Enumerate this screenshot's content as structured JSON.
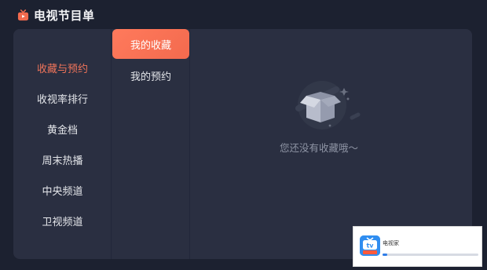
{
  "header": {
    "title": "电视节目单",
    "icon": "tv-icon",
    "icon_color": "#f36a4e"
  },
  "categories": [
    {
      "label": "收藏与预约",
      "active": true
    },
    {
      "label": "收视率排行",
      "active": false
    },
    {
      "label": "黄金档",
      "active": false
    },
    {
      "label": "周末热播",
      "active": false
    },
    {
      "label": "中央频道",
      "active": false
    },
    {
      "label": "卫视频道",
      "active": false
    }
  ],
  "subtabs": [
    {
      "label": "我的收藏",
      "active": true
    },
    {
      "label": "我的预约",
      "active": false
    }
  ],
  "empty_state": {
    "icon": "empty-box-icon",
    "message": "您还没有收藏哦～"
  },
  "popup": {
    "app_name": "电视家",
    "progress": 0.05,
    "logo_icon": "tv-app-logo-icon"
  },
  "colors": {
    "accent": "#f36a4e",
    "background": "#1c2130",
    "panel": "#2a2f41"
  }
}
